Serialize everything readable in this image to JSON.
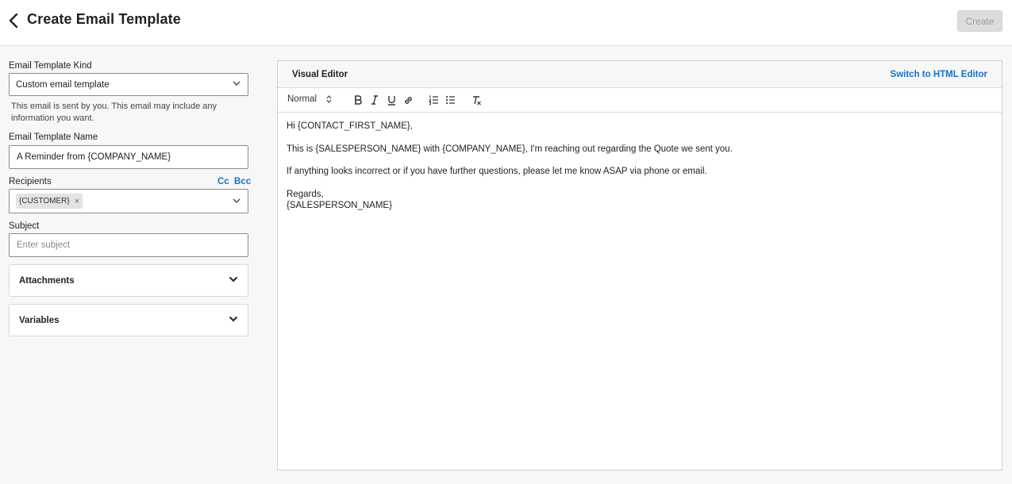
{
  "header": {
    "title": "Create Email Template",
    "create_label": "Create"
  },
  "form": {
    "kind": {
      "label": "Email Template Kind",
      "value": "Custom email template",
      "help": "This email is sent by you. This email may include any information you want."
    },
    "name": {
      "label": "Email Template Name",
      "value": "A Reminder from {COMPANY_NAME}"
    },
    "recipients": {
      "label": "Recipients",
      "cc_label": "Cc",
      "bcc_label": "Bcc",
      "chips": [
        "{CUSTOMER}"
      ],
      "chip_remove": "×"
    },
    "subject": {
      "label": "Subject",
      "placeholder": "Enter subject",
      "value": ""
    },
    "attachments_label": "Attachments",
    "variables_label": "Variables"
  },
  "editor": {
    "title": "Visual Editor",
    "switch_label": "Switch to HTML Editor",
    "format_value": "Normal",
    "body": {
      "line1": "Hi {CONTACT_FIRST_NAME},",
      "line2": "This is {SALESPERSON_NAME} with {COMPANY_NAME}, I'm reaching out regarding the Quote we sent you.",
      "line3": "If anything looks incorrect or if you have further questions, please let me know ASAP via phone or email.",
      "line4": "Regards,",
      "line5": "{SALESPERSON_NAME}"
    }
  },
  "colors": {
    "accent": "#1a6fc2",
    "disabled_button": "#dcdcdc",
    "page_bg": "#f7f7f7"
  }
}
